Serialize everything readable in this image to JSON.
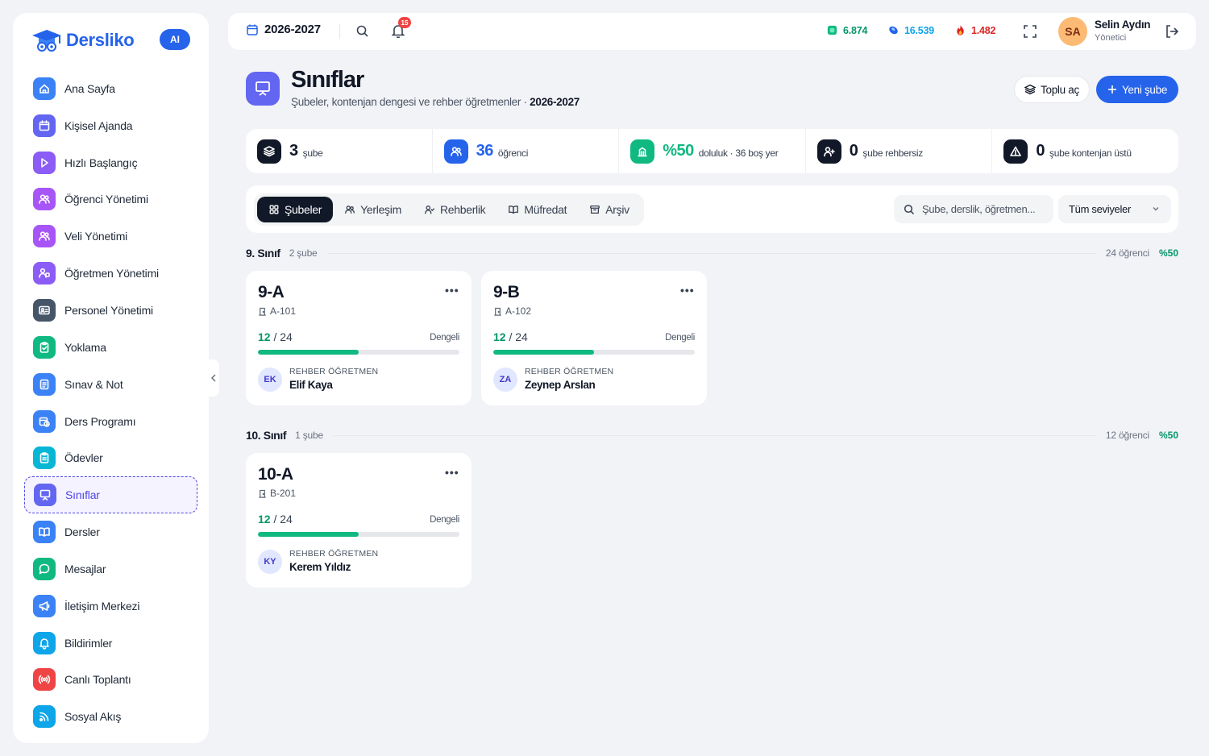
{
  "brand": {
    "name": "Dersliko",
    "ai_badge": "AI"
  },
  "sidebar": {
    "items": [
      {
        "label": "Ana Sayfa",
        "icon": "home-icon",
        "color": "#3b82f6"
      },
      {
        "label": "Kişisel Ajanda",
        "icon": "calendar-icon",
        "color": "#6366f1"
      },
      {
        "label": "Hızlı Başlangıç",
        "icon": "play-icon",
        "color": "#8b5cf6"
      },
      {
        "label": "Öğrenci Yönetimi",
        "icon": "users-icon",
        "color": "#a855f7"
      },
      {
        "label": "Veli Yönetimi",
        "icon": "users-icon",
        "color": "#a855f7"
      },
      {
        "label": "Öğretmen Yönetimi",
        "icon": "teacher-icon",
        "color": "#8b5cf6"
      },
      {
        "label": "Personel Yönetimi",
        "icon": "id-card-icon",
        "color": "#475569"
      },
      {
        "label": "Yoklama",
        "icon": "clipboard-check-icon",
        "color": "#10b981"
      },
      {
        "label": "Sınav & Not",
        "icon": "document-icon",
        "color": "#3b82f6"
      },
      {
        "label": "Ders Programı",
        "icon": "calendar-clock-icon",
        "color": "#3b82f6"
      },
      {
        "label": "Ödevler",
        "icon": "clipboard-icon",
        "color": "#06b6d4"
      },
      {
        "label": "Sınıflar",
        "icon": "presentation-icon",
        "color": "#6366f1"
      },
      {
        "label": "Dersler",
        "icon": "book-icon",
        "color": "#3b82f6"
      },
      {
        "label": "Mesajlar",
        "icon": "chat-icon",
        "color": "#10b981"
      },
      {
        "label": "İletişim Merkezi",
        "icon": "megaphone-icon",
        "color": "#3b82f6"
      },
      {
        "label": "Bildirimler",
        "icon": "bell-icon",
        "color": "#0ea5e9"
      },
      {
        "label": "Canlı Toplantı",
        "icon": "broadcast-icon",
        "color": "#ef4444"
      },
      {
        "label": "Sosyal Akış",
        "icon": "rss-icon",
        "color": "#0ea5e9"
      }
    ],
    "active_index": 11
  },
  "topbar": {
    "year": "2026-2027",
    "notification_count": "15",
    "stats": [
      {
        "value": "6.874",
        "color": "#059669",
        "icon": "gem-green-icon"
      },
      {
        "value": "16.539",
        "color": "#0ea5e9",
        "icon": "gem-blue-icon"
      },
      {
        "value": "1.482",
        "color": "#dc2626",
        "icon": "fire-icon"
      }
    ],
    "user": {
      "initials": "SA",
      "name": "Selin Aydın",
      "role": "Yönetici"
    }
  },
  "page": {
    "title": "Sınıflar",
    "subtitle": "Şubeler, kontenjan dengesi ve rehber öğretmenler · ",
    "subtitle_year": "2026-2027",
    "bulk_button": "Toplu aç",
    "new_button": "Yeni şube"
  },
  "stats": [
    {
      "value": "3",
      "label": "şube",
      "icon": "layers-icon",
      "color": "#111827"
    },
    {
      "value": "36",
      "label": "öğrenci",
      "icon": "users-icon",
      "color": "#2563eb"
    },
    {
      "value": "%50",
      "label": "doluluk · 36 boş yer",
      "icon": "building-icon",
      "color": "#10b981"
    },
    {
      "value": "0",
      "label": "şube rehbersiz",
      "icon": "user-plus-icon",
      "color": "#111827"
    },
    {
      "value": "0",
      "label": "şube kontenjan üstü",
      "icon": "warning-icon",
      "color": "#111827"
    }
  ],
  "tabs": [
    {
      "label": "Şubeler",
      "icon": "grid-icon"
    },
    {
      "label": "Yerleşim",
      "icon": "users-icon"
    },
    {
      "label": "Rehberlik",
      "icon": "user-check-icon"
    },
    {
      "label": "Müfredat",
      "icon": "book-icon"
    },
    {
      "label": "Arşiv",
      "icon": "archive-icon"
    }
  ],
  "search": {
    "placeholder": "Şube, derslik, öğretmen..."
  },
  "level_filter": {
    "value": "Tüm seviyeler"
  },
  "groups": [
    {
      "title": "9. Sınıf",
      "count": "2 şube",
      "students": "24 öğrenci",
      "fill": "%50",
      "cards": [
        {
          "name": "9-A",
          "room": "A-101",
          "enrolled": "12",
          "capacity": "/ 24",
          "fill_ratio": 0.5,
          "balance": "Dengeli",
          "teacher_label": "REHBER ÖĞRETMEN",
          "initials": "EK",
          "teacher": "Elif Kaya"
        },
        {
          "name": "9-B",
          "room": "A-102",
          "enrolled": "12",
          "capacity": "/ 24",
          "fill_ratio": 0.5,
          "balance": "Dengeli",
          "teacher_label": "REHBER ÖĞRETMEN",
          "initials": "ZA",
          "teacher": "Zeynep Arslan"
        }
      ]
    },
    {
      "title": "10. Sınıf",
      "count": "1 şube",
      "students": "12 öğrenci",
      "fill": "%50",
      "cards": [
        {
          "name": "10-A",
          "room": "B-201",
          "enrolled": "12",
          "capacity": "/ 24",
          "fill_ratio": 0.5,
          "balance": "Dengeli",
          "teacher_label": "REHBER ÖĞRETMEN",
          "initials": "KY",
          "teacher": "Kerem Yıldız"
        }
      ]
    }
  ]
}
